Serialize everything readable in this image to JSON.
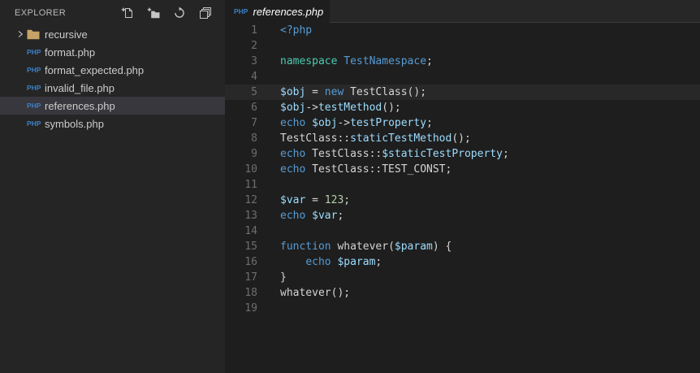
{
  "colors": {
    "keyword": "#569CD6",
    "namespaceKeyword": "#4EC9B0",
    "className": "#569CD6",
    "variable": "#9CDCFE",
    "plain": "#D4D4D4",
    "number": "#B5CEA8",
    "sidebar_bg": "#252526",
    "editor_bg": "#1E1E1E",
    "selected_row_bg": "#37373D",
    "php_icon_blue": "#3B7FC4",
    "folder_tan": "#C5A266"
  },
  "explorer": {
    "title": "EXPLORER",
    "actions": [
      {
        "name": "new-file",
        "title": "New File"
      },
      {
        "name": "new-folder",
        "title": "New Folder"
      },
      {
        "name": "refresh",
        "title": "Refresh"
      },
      {
        "name": "collapse-all",
        "title": "Collapse All"
      }
    ],
    "file_icon_label": "PHP",
    "items": [
      {
        "label": "recursive",
        "kind": "folder",
        "collapsed": true,
        "selected": false
      },
      {
        "label": "format.php",
        "kind": "php",
        "selected": false
      },
      {
        "label": "format_expected.php",
        "kind": "php",
        "selected": false
      },
      {
        "label": "invalid_file.php",
        "kind": "php",
        "selected": false
      },
      {
        "label": "references.php",
        "kind": "php",
        "selected": true
      },
      {
        "label": "symbols.php",
        "kind": "php",
        "selected": false
      }
    ]
  },
  "editor": {
    "tab": {
      "label": "references.php",
      "icon": "PHP",
      "close": "✕"
    },
    "current_line": 5,
    "lines": [
      {
        "n": 1,
        "tokens": [
          [
            "kw",
            "<?php"
          ]
        ]
      },
      {
        "n": 2,
        "tokens": []
      },
      {
        "n": 3,
        "tokens": [
          [
            "ns",
            "namespace"
          ],
          [
            "pl",
            " "
          ],
          [
            "cl",
            "TestNamespace"
          ],
          [
            "pl",
            ";"
          ]
        ]
      },
      {
        "n": 4,
        "tokens": []
      },
      {
        "n": 5,
        "tokens": [
          [
            "var",
            "$obj"
          ],
          [
            "pl",
            " = "
          ],
          [
            "kw",
            "new"
          ],
          [
            "pl",
            " TestClass();"
          ]
        ]
      },
      {
        "n": 6,
        "tokens": [
          [
            "var",
            "$obj"
          ],
          [
            "pl",
            "->"
          ],
          [
            "var",
            "testMethod"
          ],
          [
            "pl",
            "();"
          ]
        ]
      },
      {
        "n": 7,
        "tokens": [
          [
            "kw",
            "echo"
          ],
          [
            "pl",
            " "
          ],
          [
            "var",
            "$obj"
          ],
          [
            "pl",
            "->"
          ],
          [
            "var",
            "testProperty"
          ],
          [
            "pl",
            ";"
          ]
        ]
      },
      {
        "n": 8,
        "tokens": [
          [
            "pl",
            "TestClass::"
          ],
          [
            "var",
            "staticTestMethod"
          ],
          [
            "pl",
            "();"
          ]
        ]
      },
      {
        "n": 9,
        "tokens": [
          [
            "kw",
            "echo"
          ],
          [
            "pl",
            " TestClass::"
          ],
          [
            "var",
            "$staticTestProperty"
          ],
          [
            "pl",
            ";"
          ]
        ]
      },
      {
        "n": 10,
        "tokens": [
          [
            "kw",
            "echo"
          ],
          [
            "pl",
            " TestClass::TEST_CONST;"
          ]
        ]
      },
      {
        "n": 11,
        "tokens": []
      },
      {
        "n": 12,
        "tokens": [
          [
            "var",
            "$var"
          ],
          [
            "pl",
            " = "
          ],
          [
            "num",
            "123"
          ],
          [
            "pl",
            ";"
          ]
        ]
      },
      {
        "n": 13,
        "tokens": [
          [
            "kw",
            "echo"
          ],
          [
            "pl",
            " "
          ],
          [
            "var",
            "$var"
          ],
          [
            "pl",
            ";"
          ]
        ]
      },
      {
        "n": 14,
        "tokens": []
      },
      {
        "n": 15,
        "tokens": [
          [
            "kw",
            "function"
          ],
          [
            "pl",
            " whatever("
          ],
          [
            "var",
            "$param"
          ],
          [
            "pl",
            ") {"
          ]
        ]
      },
      {
        "n": 16,
        "tokens": [
          [
            "pl",
            "    "
          ],
          [
            "kw",
            "echo"
          ],
          [
            "pl",
            " "
          ],
          [
            "var",
            "$param"
          ],
          [
            "pl",
            ";"
          ]
        ]
      },
      {
        "n": 17,
        "tokens": [
          [
            "pl",
            "}"
          ]
        ]
      },
      {
        "n": 18,
        "tokens": [
          [
            "pl",
            "whatever();"
          ]
        ]
      },
      {
        "n": 19,
        "tokens": []
      }
    ]
  }
}
